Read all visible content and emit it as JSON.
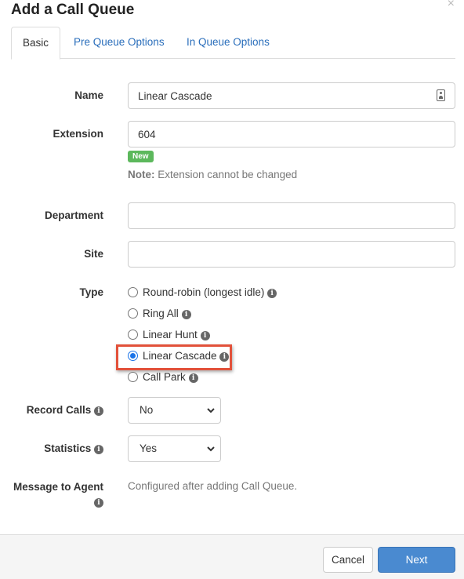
{
  "modal": {
    "title": "Add a Call Queue",
    "close": "×"
  },
  "tabs": [
    {
      "label": "Basic"
    },
    {
      "label": "Pre Queue Options"
    },
    {
      "label": "In Queue Options"
    }
  ],
  "form": {
    "name": {
      "label": "Name",
      "value": "Linear Cascade"
    },
    "extension": {
      "label": "Extension",
      "value": "604",
      "badge": "New",
      "note_bold": "Note:",
      "note_text": " Extension cannot be changed"
    },
    "department": {
      "label": "Department",
      "value": ""
    },
    "site": {
      "label": "Site",
      "value": ""
    },
    "type": {
      "label": "Type",
      "options": [
        {
          "label": "Round-robin (longest idle)",
          "checked": false
        },
        {
          "label": "Ring All",
          "checked": false
        },
        {
          "label": "Linear Hunt",
          "checked": false
        },
        {
          "label": "Linear Cascade",
          "checked": true
        },
        {
          "label": "Call Park",
          "checked": false
        }
      ]
    },
    "record_calls": {
      "label": "Record Calls",
      "value": "No"
    },
    "statistics": {
      "label": "Statistics",
      "value": "Yes"
    },
    "message_to_agent": {
      "label": "Message to Agent",
      "value": "Configured after adding Call Queue."
    }
  },
  "footer": {
    "cancel_label": "Cancel",
    "next_label": "Next"
  },
  "icons": {
    "info": "i"
  },
  "colors": {
    "accent": "#4a8ad0",
    "link": "#2a6ebb",
    "badge": "#5cb85c",
    "highlight": "#e2513a"
  }
}
